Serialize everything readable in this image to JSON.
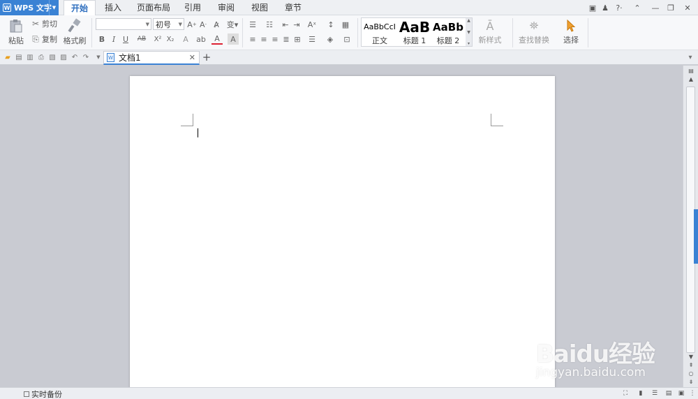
{
  "app": {
    "name": "WPS 文字",
    "logo_glyph": "W"
  },
  "menu_tabs": [
    "开始",
    "插入",
    "页面布局",
    "引用",
    "审阅",
    "视图",
    "章节"
  ],
  "active_tab": "开始",
  "ribbon": {
    "paste": "粘贴",
    "cut": "剪切",
    "copy": "复制",
    "format_painter": "格式刷",
    "font_name": "",
    "font_size": "初号",
    "bold": "B",
    "italic": "I",
    "underline": "U",
    "strike": "AB",
    "superscript": "X²",
    "subscript": "X₂",
    "styles": [
      {
        "preview": "AaBbCcI",
        "name": "正文"
      },
      {
        "preview": "AaB",
        "name": "标题 1"
      },
      {
        "preview": "AaBb",
        "name": "标题 2"
      }
    ],
    "new_style": "新样式",
    "find_replace": "查找替换",
    "select": "选择"
  },
  "document_tab": {
    "title": "文档1"
  },
  "statusbar": {
    "backup": "实时备份"
  },
  "watermark": {
    "main": "Baidu经验",
    "sub": "jingyan.baidu.com"
  },
  "colors": {
    "accent": "#3a82d4",
    "workspace": "#c9cbd2",
    "ribbon_bg": "#f7f8fa"
  }
}
